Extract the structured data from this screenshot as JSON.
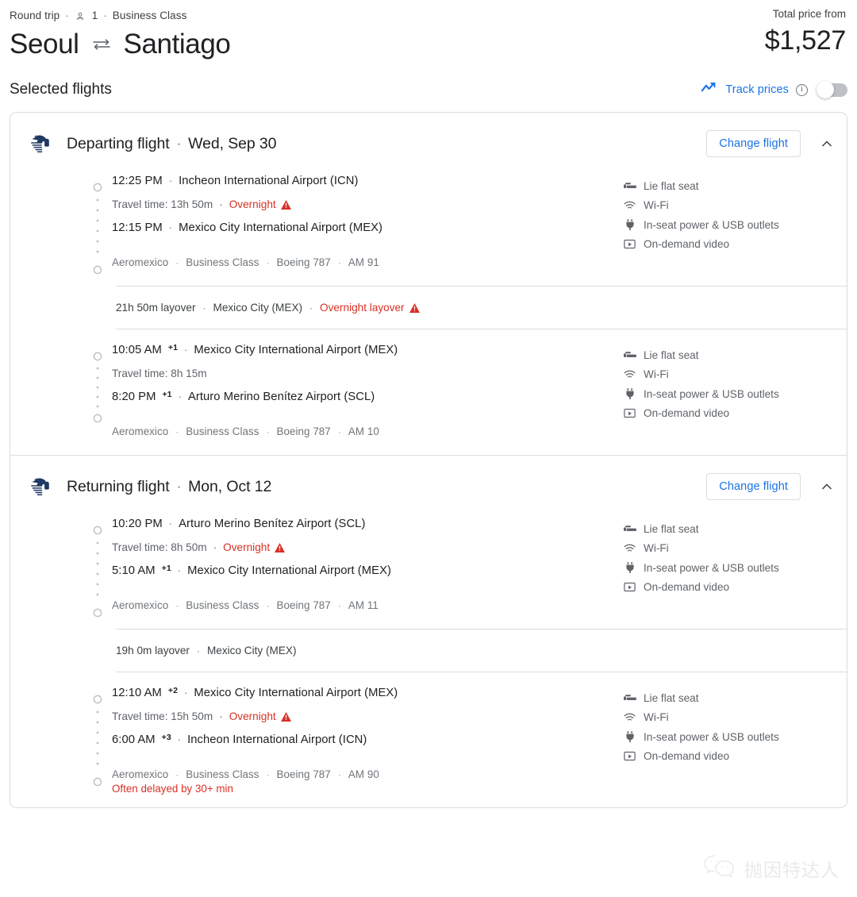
{
  "header": {
    "trip_type": "Round trip",
    "passengers": "1",
    "cabin": "Business Class",
    "origin": "Seoul",
    "destination": "Santiago",
    "price_label": "Total price from",
    "price_value": "$1,527",
    "dot": "·"
  },
  "selected": {
    "title": "Selected flights",
    "track_label": "Track prices",
    "info": "i",
    "toggle_on": false
  },
  "colors": {
    "accent": "#1a73e8",
    "warning": "#d93025",
    "airline_blue": "#1f3864",
    "text": "#202124",
    "muted": "#5f6368",
    "border": "#dadce0"
  },
  "legs": [
    {
      "name": "Departing flight",
      "date": "Wed, Sep 30",
      "change_label": "Change flight",
      "collapse_icon": "chevron-up-icon",
      "airline_logo": "aeromexico-logo",
      "segments": [
        {
          "depart_time": "12:25 PM",
          "depart_sup": "",
          "depart_airport": "Incheon International Airport (ICN)",
          "travel_time": "Travel time: 13h 50m",
          "warning": "Overnight",
          "arrive_time": "12:15 PM",
          "arrive_sup": "",
          "arrive_airport": "Mexico City International Airport (MEX)",
          "operator": "Aeromexico",
          "cabin": "Business Class",
          "aircraft": "Boeing 787",
          "flight_no": "AM 91",
          "delay_note": "",
          "amenities": [
            {
              "icon": "lie-flat-seat-icon",
              "label": "Lie flat seat"
            },
            {
              "icon": "wifi-icon",
              "label": "Wi-Fi"
            },
            {
              "icon": "power-outlet-icon",
              "label": "In-seat power & USB outlets"
            },
            {
              "icon": "on-demand-video-icon",
              "label": "On-demand video"
            }
          ]
        },
        {
          "depart_time": "10:05 AM",
          "depart_sup": "+1",
          "depart_airport": "Mexico City International Airport (MEX)",
          "travel_time": "Travel time: 8h 15m",
          "warning": "",
          "arrive_time": "8:20 PM",
          "arrive_sup": "+1",
          "arrive_airport": "Arturo Merino Benítez Airport (SCL)",
          "operator": "Aeromexico",
          "cabin": "Business Class",
          "aircraft": "Boeing 787",
          "flight_no": "AM 10",
          "delay_note": "",
          "amenities": [
            {
              "icon": "lie-flat-seat-icon",
              "label": "Lie flat seat"
            },
            {
              "icon": "wifi-icon",
              "label": "Wi-Fi"
            },
            {
              "icon": "power-outlet-icon",
              "label": "In-seat power & USB outlets"
            },
            {
              "icon": "on-demand-video-icon",
              "label": "On-demand video"
            }
          ]
        }
      ],
      "layover": {
        "duration": "21h 50m layover",
        "place": "Mexico City (MEX)",
        "warning": "Overnight layover"
      }
    },
    {
      "name": "Returning flight",
      "date": "Mon, Oct 12",
      "change_label": "Change flight",
      "collapse_icon": "chevron-up-icon",
      "airline_logo": "aeromexico-logo",
      "segments": [
        {
          "depart_time": "10:20 PM",
          "depart_sup": "",
          "depart_airport": "Arturo Merino Benítez Airport (SCL)",
          "travel_time": "Travel time: 8h 50m",
          "warning": "Overnight",
          "arrive_time": "5:10 AM",
          "arrive_sup": "+1",
          "arrive_airport": "Mexico City International Airport (MEX)",
          "operator": "Aeromexico",
          "cabin": "Business Class",
          "aircraft": "Boeing 787",
          "flight_no": "AM 11",
          "delay_note": "",
          "amenities": [
            {
              "icon": "lie-flat-seat-icon",
              "label": "Lie flat seat"
            },
            {
              "icon": "wifi-icon",
              "label": "Wi-Fi"
            },
            {
              "icon": "power-outlet-icon",
              "label": "In-seat power & USB outlets"
            },
            {
              "icon": "on-demand-video-icon",
              "label": "On-demand video"
            }
          ]
        },
        {
          "depart_time": "12:10 AM",
          "depart_sup": "+2",
          "depart_airport": "Mexico City International Airport (MEX)",
          "travel_time": "Travel time: 15h 50m",
          "warning": "Overnight",
          "arrive_time": "6:00 AM",
          "arrive_sup": "+3",
          "arrive_airport": "Incheon International Airport (ICN)",
          "operator": "Aeromexico",
          "cabin": "Business Class",
          "aircraft": "Boeing 787",
          "flight_no": "AM 90",
          "delay_note": "Often delayed by 30+ min",
          "amenities": [
            {
              "icon": "lie-flat-seat-icon",
              "label": "Lie flat seat"
            },
            {
              "icon": "wifi-icon",
              "label": "Wi-Fi"
            },
            {
              "icon": "power-outlet-icon",
              "label": "In-seat power & USB outlets"
            },
            {
              "icon": "on-demand-video-icon",
              "label": "On-demand video"
            }
          ]
        }
      ],
      "layover": {
        "duration": "19h 0m layover",
        "place": "Mexico City (MEX)",
        "warning": ""
      }
    }
  ],
  "watermark": {
    "text": "抛因特达人",
    "icon": "wechat-icon"
  }
}
